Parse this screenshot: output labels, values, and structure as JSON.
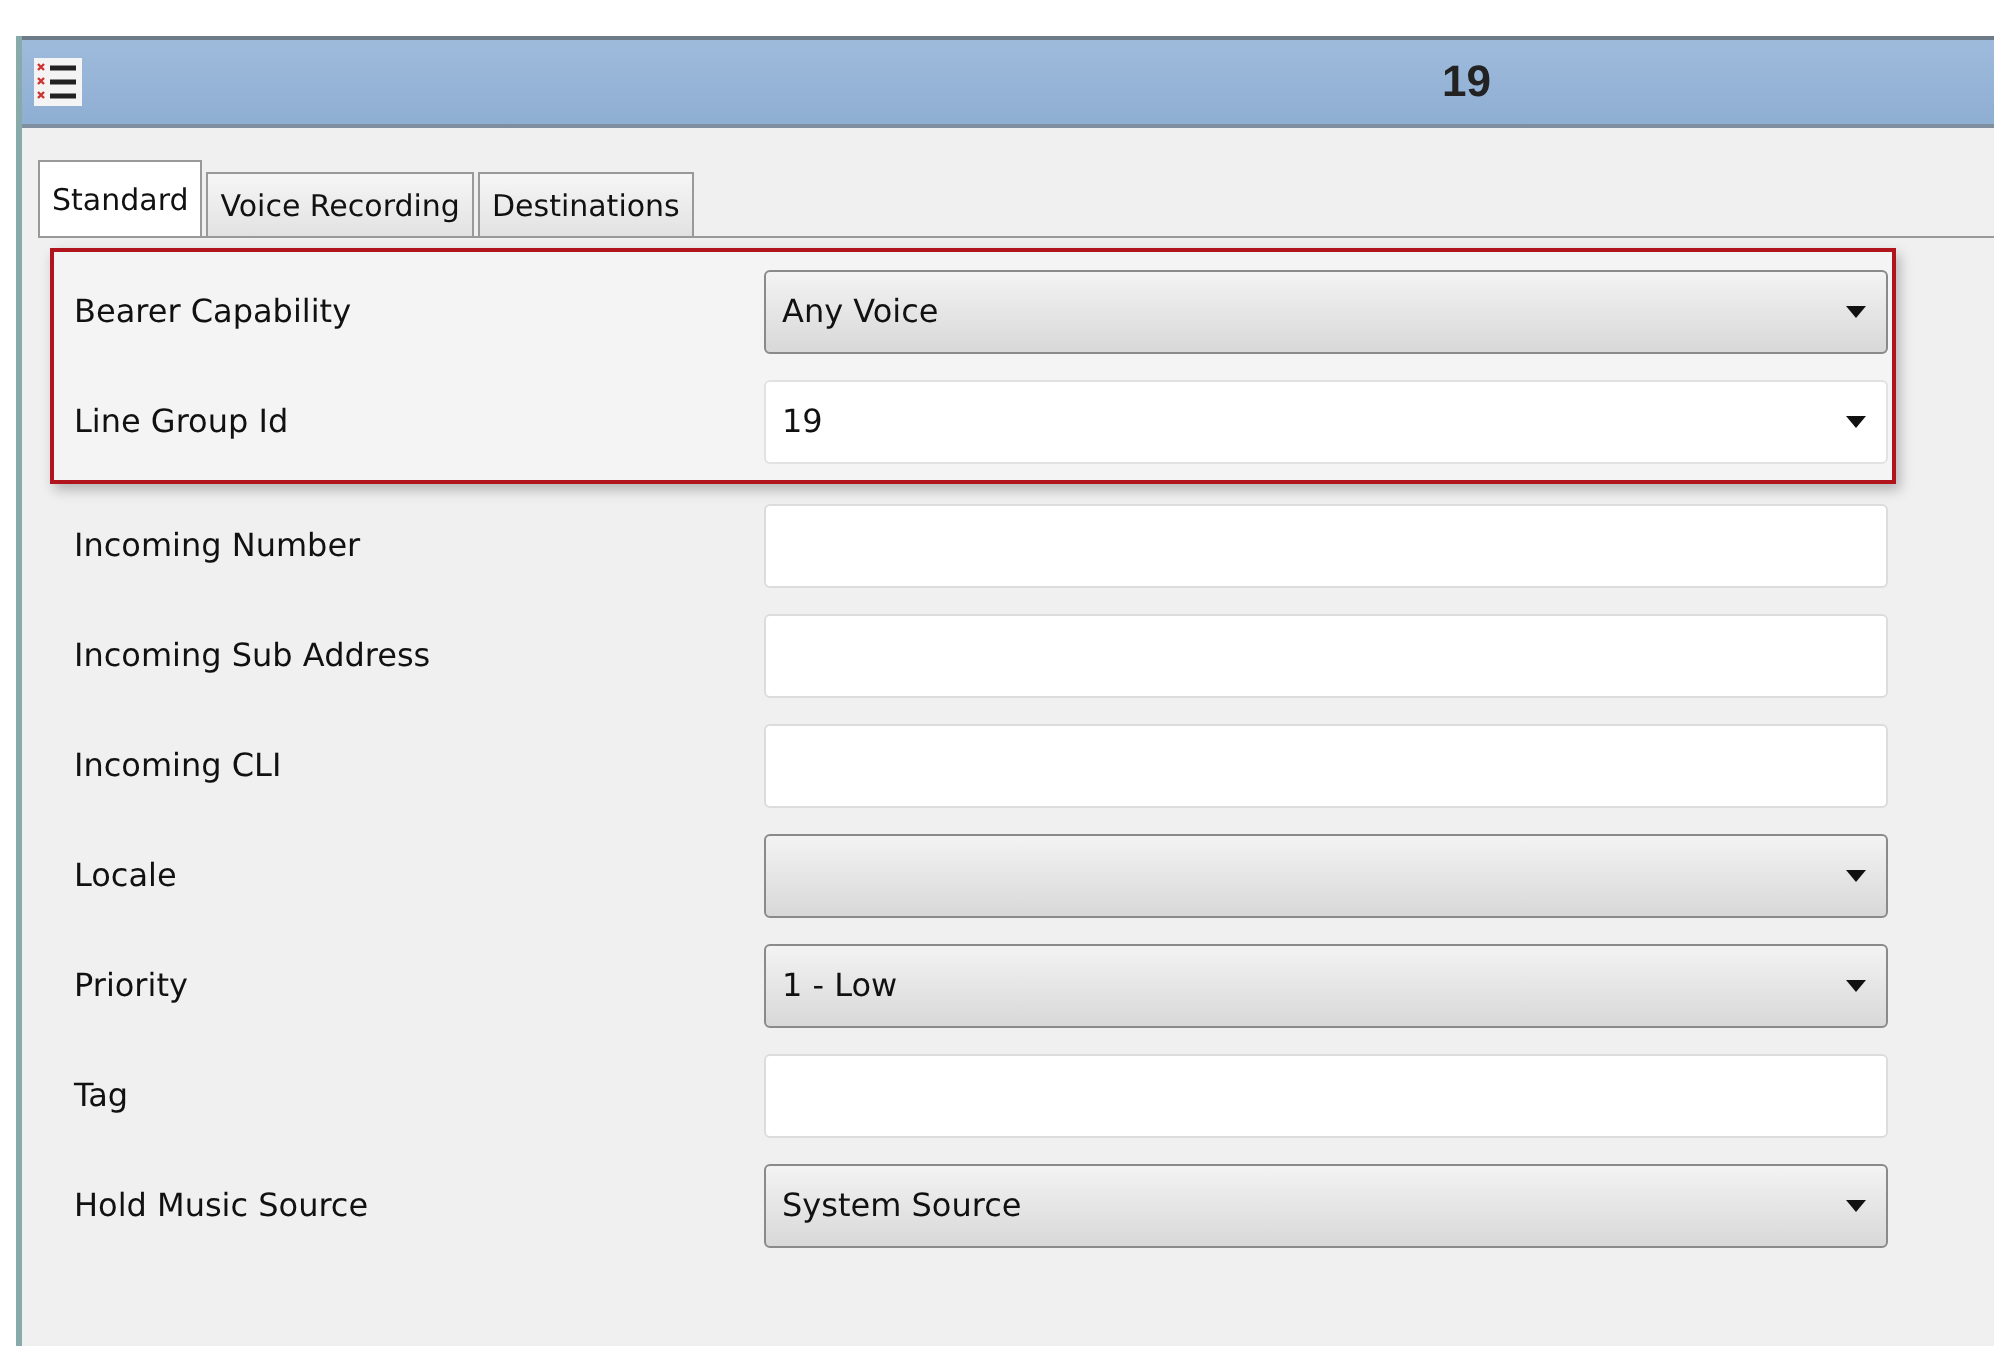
{
  "window": {
    "title": "19"
  },
  "tabs": [
    {
      "label": "Standard",
      "selected": true
    },
    {
      "label": "Voice Recording",
      "selected": false
    },
    {
      "label": "Destinations",
      "selected": false
    }
  ],
  "sections": [
    {
      "highlighted": true,
      "rows": [
        {
          "label": "Bearer Capability",
          "kind": "dropdown",
          "value": "Any Voice"
        },
        {
          "label": "Line Group Id",
          "kind": "combo",
          "value": "19"
        }
      ]
    },
    {
      "highlighted": false,
      "rows": [
        {
          "label": "Incoming Number",
          "kind": "text"
        },
        {
          "label": "Incoming Sub Address",
          "kind": "text"
        },
        {
          "label": "Incoming CLI",
          "kind": "text"
        },
        {
          "label": "Locale",
          "kind": "dropdown"
        },
        {
          "label": "Priority",
          "kind": "dropdown",
          "value": "1 - Low"
        },
        {
          "label": "Tag",
          "kind": "text"
        },
        {
          "label": "Hold Music Source",
          "kind": "dropdown",
          "value": "System Source"
        }
      ]
    }
  ]
}
